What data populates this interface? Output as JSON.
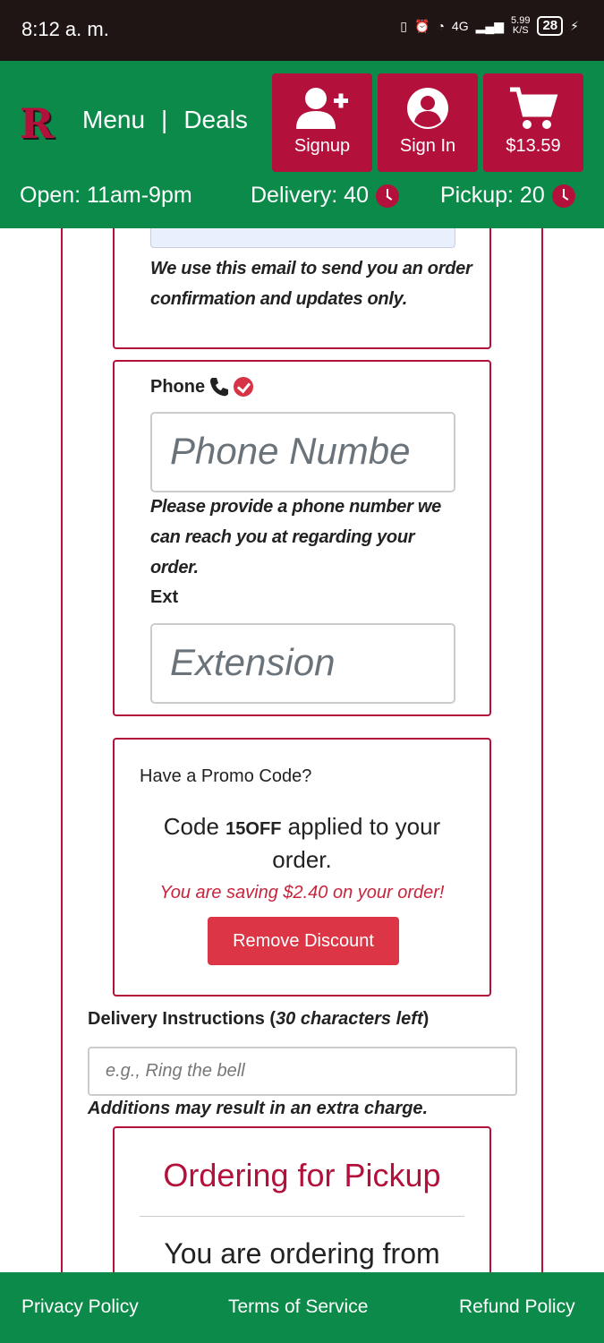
{
  "status_bar": {
    "time": "8:12 a. m.",
    "network": "4G",
    "speed": "5.99",
    "speed_unit": "K/S",
    "battery": "28"
  },
  "header": {
    "logo_letter": "R",
    "menu_label": "Menu",
    "separator": "|",
    "deals_label": "Deals",
    "signup_label": "Signup",
    "signin_label": "Sign In",
    "cart_total": "$13.59",
    "open_hours": "Open: 11am-9pm",
    "delivery_time": "Delivery: 40",
    "pickup_time": "Pickup: 20",
    "colors": {
      "green": "#0b8a4a",
      "crimson": "#b3103c"
    }
  },
  "email_card": {
    "note": "We use this email to send you an order confirmation and updates only."
  },
  "phone_card": {
    "label": "Phone",
    "phone_placeholder": "Phone Numbe",
    "note": "Please provide a phone number we can reach you at regarding your order.",
    "ext_label": "Ext",
    "ext_placeholder": "Extension"
  },
  "promo_card": {
    "title": "Have a Promo Code?",
    "applied_prefix": "Code ",
    "code": "15OFF",
    "applied_suffix": " applied to your order.",
    "saving": "You are saving $2.40 on your order!",
    "remove_label": "Remove Discount"
  },
  "delivery": {
    "label": "Delivery Instructions (",
    "chars_left": "30 characters left",
    "label_close": ")",
    "placeholder": "e.g., Ring the bell",
    "note": "Additions may result in an extra charge."
  },
  "pickup_card": {
    "title": "Ordering for Pickup",
    "subtitle": "You are ordering from"
  },
  "footer": {
    "privacy": "Privacy Policy",
    "terms": "Terms of Service",
    "refund": "Refund Policy"
  }
}
